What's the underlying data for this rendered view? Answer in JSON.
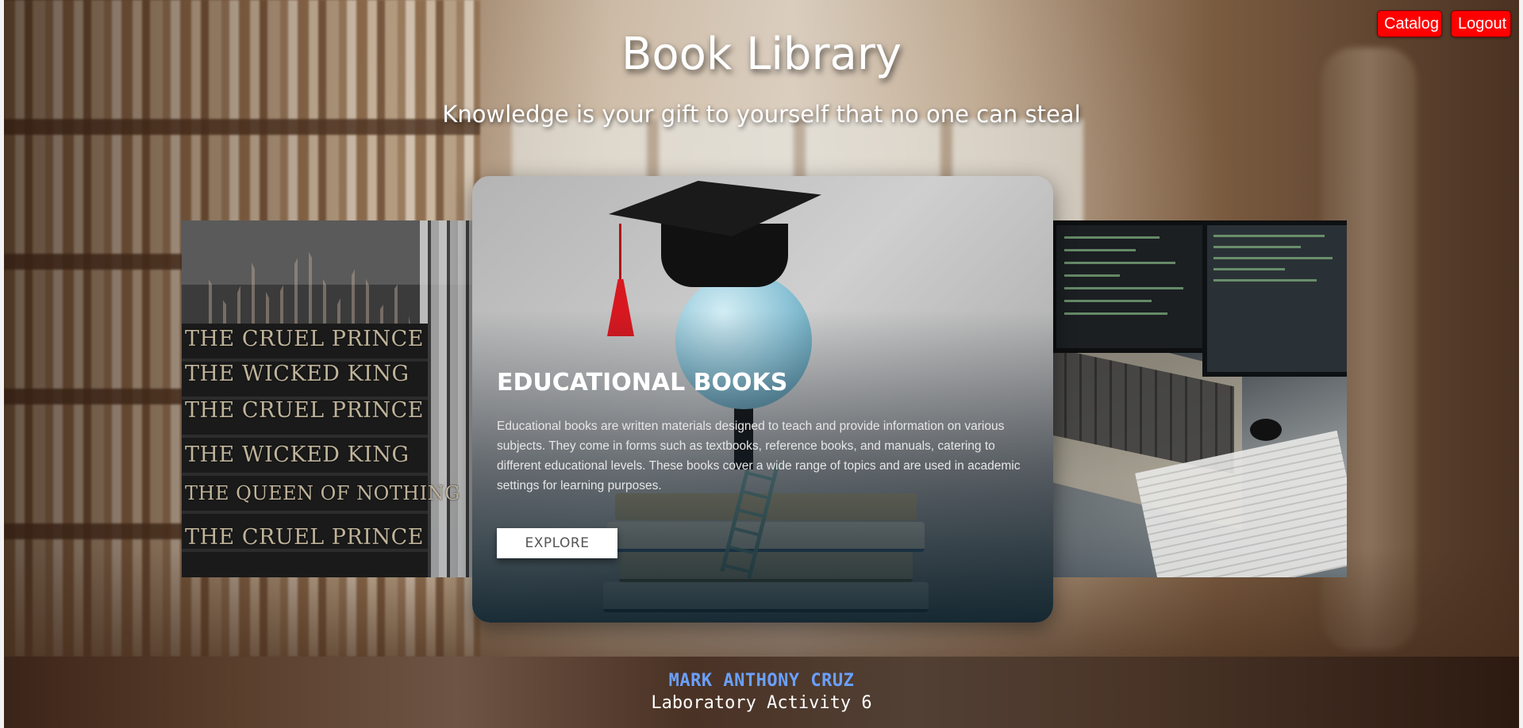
{
  "header": {
    "title": "Book Library",
    "tagline": "Knowledge is your gift to yourself that no one can steal"
  },
  "nav": {
    "catalog_label": "Catalog",
    "logout_label": "Logout",
    "button_color": "#ff0000"
  },
  "carousel": {
    "active": {
      "title": "EDUCATIONAL BOOKS",
      "description": "Educational books are written materials designed to teach and provide information on various subjects. They come in forms such as textbooks, reference books, and manuals, catering to different educational levels. These books cover a wide range of topics and are used in academic settings for learning purposes.",
      "button_label": "EXPLORE"
    },
    "left_slide": {
      "spine_titles": [
        "THE CRUEL PRINCE",
        "THE WICKED KING",
        "THE CRUEL PRINCE",
        "THE WICKED KING",
        "THE QUEEN OF NOTHING",
        "THE CRUEL PRINCE"
      ]
    }
  },
  "footer": {
    "name": "MARK ANTHONY CRUZ",
    "subtitle": "Laboratory Activity 6",
    "name_color": "#6aa0ff"
  }
}
